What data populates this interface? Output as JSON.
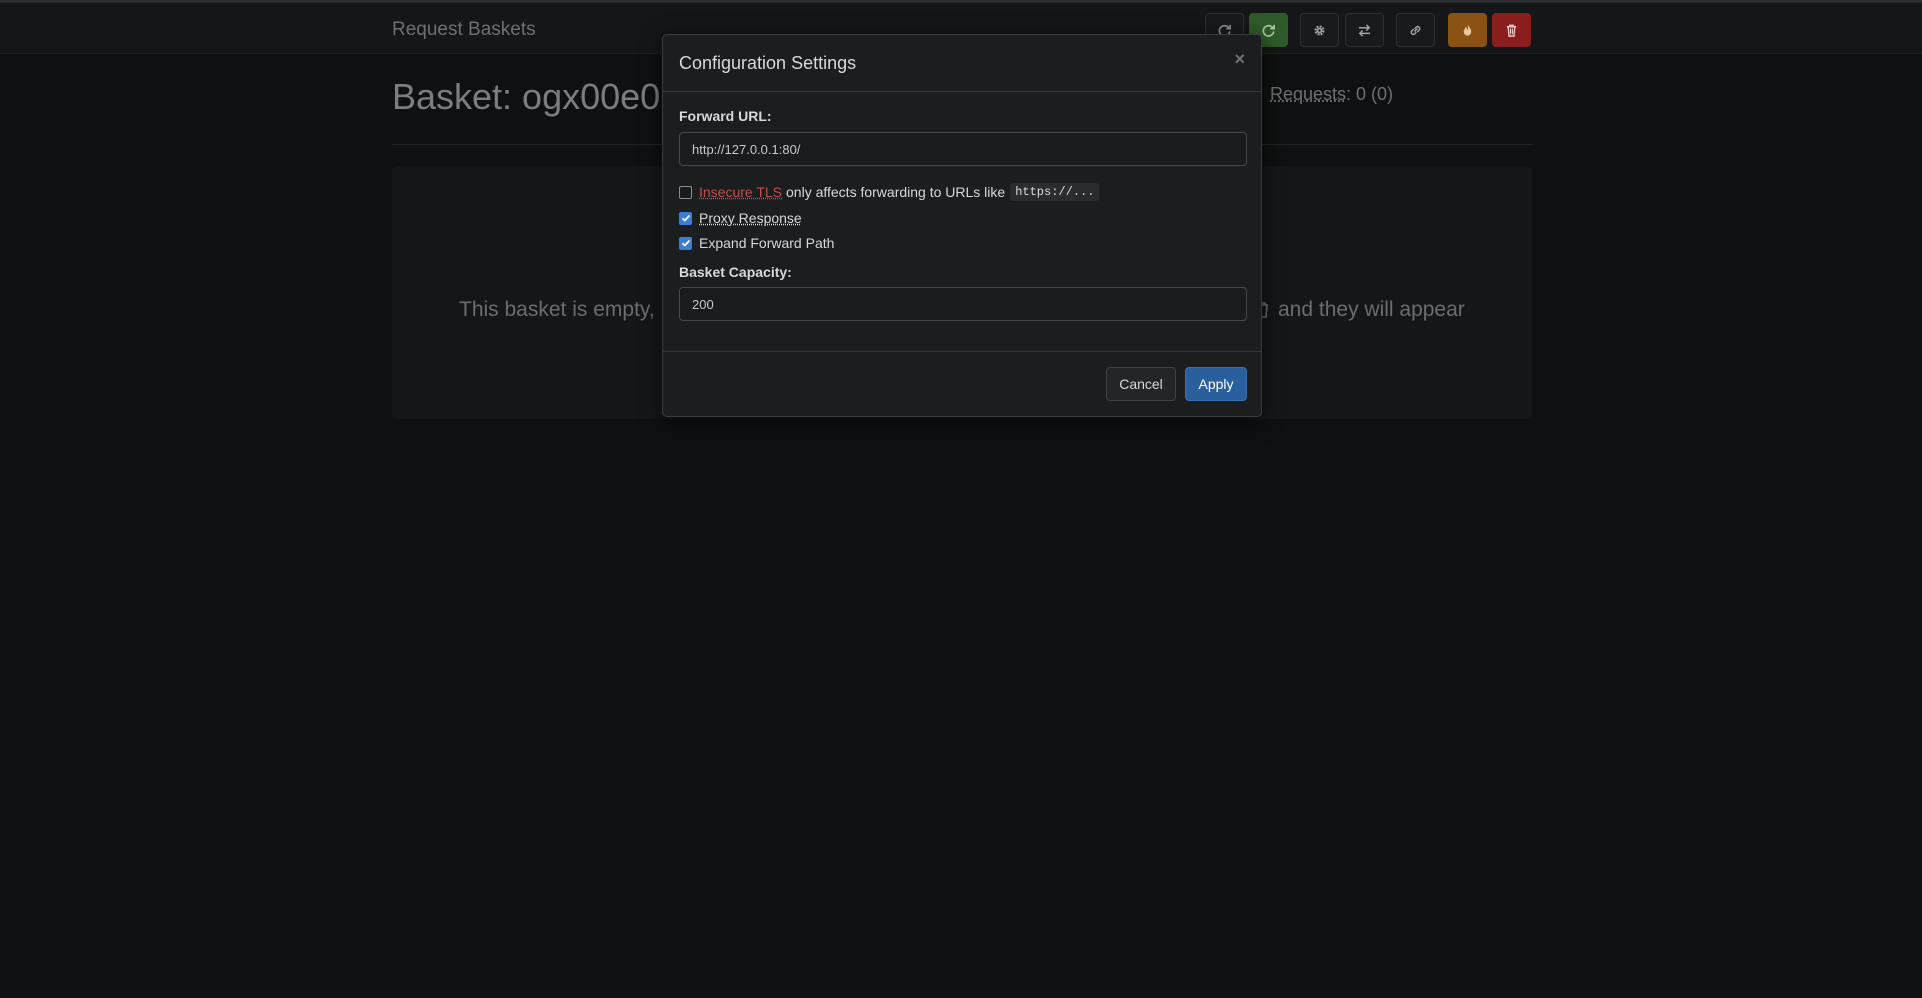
{
  "navbar": {
    "brand": "Request Baskets",
    "buttons": [
      {
        "name": "refresh-button",
        "icon": "refresh-icon",
        "style": "default"
      },
      {
        "name": "auto-refresh-button",
        "icon": "refresh-icon",
        "style": "green"
      },
      {
        "name": "settings-button",
        "icon": "gear-icon",
        "style": "default"
      },
      {
        "name": "responses-button",
        "icon": "exchange-icon",
        "style": "default"
      },
      {
        "name": "share-link-button",
        "icon": "link-icon",
        "style": "default"
      },
      {
        "name": "clear-button",
        "icon": "fire-icon",
        "style": "orange"
      },
      {
        "name": "delete-button",
        "icon": "trash-icon",
        "style": "red"
      }
    ]
  },
  "basket": {
    "title": "Basket: ogx00e0",
    "requests_label": "Requests",
    "requests_count": ": 0 (0)"
  },
  "empty_state": {
    "text_left": "This basket is empty,",
    "text_right": "and they will appear"
  },
  "modal": {
    "title": "Configuration Settings",
    "close": "×",
    "forward_url_label": "Forward URL:",
    "forward_url_value": "http://127.0.0.1:80/",
    "insecure_tls": {
      "label": "Insecure TLS",
      "suffix": "only affects forwarding to URLs like",
      "code": "https://...",
      "checked": false
    },
    "proxy_response": {
      "label": "Proxy Response",
      "checked": true
    },
    "expand_forward_path": {
      "label": "Expand Forward Path",
      "checked": true
    },
    "capacity_label": "Basket Capacity:",
    "capacity_value": "200",
    "cancel_label": "Cancel",
    "apply_label": "Apply"
  },
  "colors": {
    "accent": "#2a5f9e",
    "checkbox": "#3d7dd8",
    "danger_link": "#c0504d",
    "green_btn": "#2f5b2a",
    "orange_btn": "#8a5214",
    "red_btn": "#8a1e1e"
  }
}
